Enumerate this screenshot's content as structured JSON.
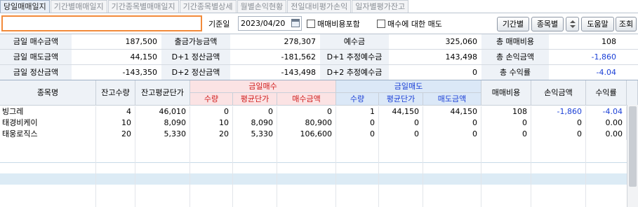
{
  "tabs": [
    "당일매매일지",
    "기간별매매일지",
    "기간종목별매매일지",
    "기간종목별상세",
    "월별손익현황",
    "전일대비평가손익",
    "일자별평가잔고"
  ],
  "toolbar": {
    "account_value": "",
    "base_date_label": "기준일",
    "base_date": "2023/04/20",
    "include_fee_label": "매매비용포함",
    "buy_sell_label": "매수에 대한 매도",
    "btn_period": "기간별",
    "btn_stock": "종목별",
    "btn_help": "도움말",
    "btn_query": "조회"
  },
  "summary": {
    "rows": [
      [
        {
          "label": "금일 매수금액",
          "value": "187,500"
        },
        {
          "label": "출금가능금액",
          "value": "278,307"
        },
        {
          "label": "예수금",
          "value": "325,060"
        },
        {
          "label": "총 매매비용",
          "value": "108"
        }
      ],
      [
        {
          "label": "금일 매도금액",
          "value": "44,150"
        },
        {
          "label": "D+1 정산금액",
          "value": "-181,562"
        },
        {
          "label": "D+1 추정예수금",
          "value": "143,498"
        },
        {
          "label": "총 손익금액",
          "value": "-1,860"
        }
      ],
      [
        {
          "label": "금일 정산금액",
          "value": "-143,350"
        },
        {
          "label": "D+2 정산금액",
          "value": "-143,498"
        },
        {
          "label": "D+2 추정예수금",
          "value": "0"
        },
        {
          "label": "총 수익률",
          "value": "-4.04"
        }
      ]
    ]
  },
  "grid": {
    "headers": {
      "stock_name": "종목명",
      "balance_qty": "잔고수량",
      "balance_avg": "잔고평균단가",
      "buy_group": "금일매수",
      "buy_qty": "수량",
      "buy_avg": "평균단가",
      "buy_amount": "매수금액",
      "sell_group": "금일매도",
      "sell_qty": "수량",
      "sell_avg": "평균단가",
      "sell_amount": "매도금액",
      "fee": "매매비용",
      "pnl": "손익금액",
      "rate": "수익률"
    },
    "rows": [
      {
        "name": "빙그레",
        "bal_qty": "4",
        "bal_avg": "46,010",
        "buy_qty": "0",
        "buy_avg": "0",
        "buy_amt": "0",
        "sell_qty": "1",
        "sell_avg": "44,150",
        "sell_amt": "44,150",
        "fee": "108",
        "pnl": "-1,860",
        "rate": "-4.04"
      },
      {
        "name": "태경비케이",
        "bal_qty": "10",
        "bal_avg": "8,090",
        "buy_qty": "10",
        "buy_avg": "8,090",
        "buy_amt": "80,900",
        "sell_qty": "0",
        "sell_avg": "0",
        "sell_amt": "0",
        "fee": "0",
        "pnl": "0",
        "rate": "0.00"
      },
      {
        "name": "태웅로직스",
        "bal_qty": "20",
        "bal_avg": "5,330",
        "buy_qty": "20",
        "buy_avg": "5,330",
        "buy_amt": "106,600",
        "sell_qty": "0",
        "sell_avg": "0",
        "sell_amt": "0",
        "fee": "0",
        "pnl": "0",
        "rate": "0.00"
      }
    ],
    "empty_rows": 6
  },
  "colors": {
    "accent_orange": "#f28a3a",
    "negative_blue": "#1a3fd6",
    "buy_red": "#d01a1a",
    "stripe_blue": "#dcebf5"
  }
}
